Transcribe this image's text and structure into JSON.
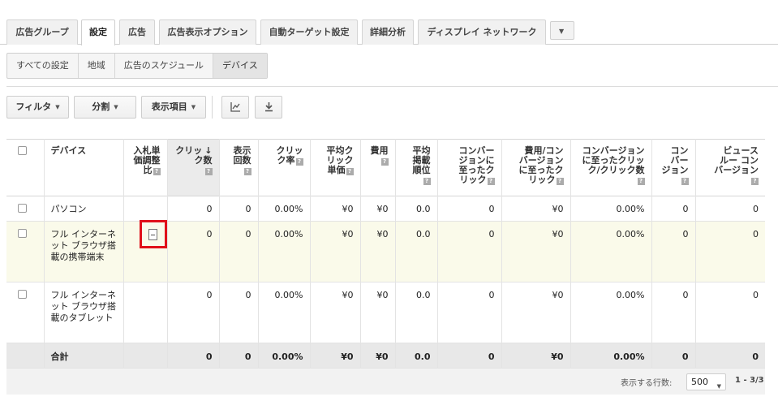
{
  "tabs": [
    {
      "label": "広告グループ",
      "active": false
    },
    {
      "label": "設定",
      "active": true
    },
    {
      "label": "広告",
      "active": false
    },
    {
      "label": "広告表示オプション",
      "active": false
    },
    {
      "label": "自動ターゲット設定",
      "active": false
    },
    {
      "label": "詳細分析",
      "active": false
    },
    {
      "label": "ディスプレイ ネットワーク",
      "active": false
    }
  ],
  "subtabs": [
    {
      "label": "すべての設定",
      "active": false
    },
    {
      "label": "地域",
      "active": false
    },
    {
      "label": "広告のスケジュール",
      "active": false
    },
    {
      "label": "デバイス",
      "active": true
    }
  ],
  "toolbar": {
    "filter_label": "フィルタ",
    "segment_label": "分割",
    "columns_label": "表示項目",
    "chart_icon": "line-chart-icon",
    "download_icon": "download-icon"
  },
  "table": {
    "headers": {
      "device": "デバイス",
      "bid_adj_1": "入札単",
      "bid_adj_2": "価調整",
      "bid_adj_3": "比",
      "clicks_1": "クリッ",
      "clicks_2": "ク数",
      "impr_1": "表示",
      "impr_2": "回数",
      "ctr_1": "クリッ",
      "ctr_2": "ク率",
      "avgcpc_1": "平均ク",
      "avgcpc_2": "リック",
      "avgcpc_3": "単価",
      "cost_1": "費用",
      "avgpos_1": "平均",
      "avgpos_2": "掲載",
      "avgpos_3": "順位",
      "convclicks_1": "コンバー",
      "convclicks_2": "ジョンに",
      "convclicks_3": "至ったク",
      "convclicks_4": "リック",
      "costconv_1": "費用/コン",
      "costconv_2": "バージョン",
      "costconv_3": "に至ったク",
      "costconv_4": "リック",
      "convrate_1": "コンバージョン",
      "convrate_2": "に至ったクリッ",
      "convrate_3": "ク/クリック数",
      "conv_1": "コン",
      "conv_2": "バー",
      "conv_3": "ジョン",
      "vt_1": "ビュース",
      "vt_2": "ルー コン",
      "vt_3": "バージョン"
    },
    "rows": [
      {
        "device": "パソコン",
        "bid_adj": "",
        "clicks": "0",
        "impr": "0",
        "ctr": "0.00%",
        "avgcpc": "¥0",
        "cost": "¥0",
        "avgpos": "0.0",
        "convclicks": "0",
        "costconv": "¥0",
        "convrate": "0.00%",
        "conv": "0",
        "vt": "0"
      },
      {
        "device": "フル インターネット ブラウザ搭載の携帯端末",
        "bid_adj": "–",
        "clicks": "0",
        "impr": "0",
        "ctr": "0.00%",
        "avgcpc": "¥0",
        "cost": "¥0",
        "avgpos": "0.0",
        "convclicks": "0",
        "costconv": "¥0",
        "convrate": "0.00%",
        "conv": "0",
        "vt": "0"
      },
      {
        "device": "フル インターネット ブラウザ搭載のタブレット",
        "bid_adj": "",
        "clicks": "0",
        "impr": "0",
        "ctr": "0.00%",
        "avgcpc": "¥0",
        "cost": "¥0",
        "avgpos": "0.0",
        "convclicks": "0",
        "costconv": "¥0",
        "convrate": "0.00%",
        "conv": "0",
        "vt": "0"
      }
    ],
    "total": {
      "label": "合計",
      "clicks": "0",
      "impr": "0",
      "ctr": "0.00%",
      "avgcpc": "¥0",
      "cost": "¥0",
      "avgpos": "0.0",
      "convclicks": "0",
      "costconv": "¥0",
      "convrate": "0.00%",
      "conv": "0",
      "vt": "0"
    }
  },
  "footer": {
    "rows_label": "表示する行数:",
    "rows_value": "500",
    "range": "1 - 3/3"
  },
  "colors": {
    "highlight_row": "#fafaea",
    "highlight_box": "#e0101a",
    "sorted_header": "#ebebeb",
    "total_row": "#e8e8e8"
  }
}
